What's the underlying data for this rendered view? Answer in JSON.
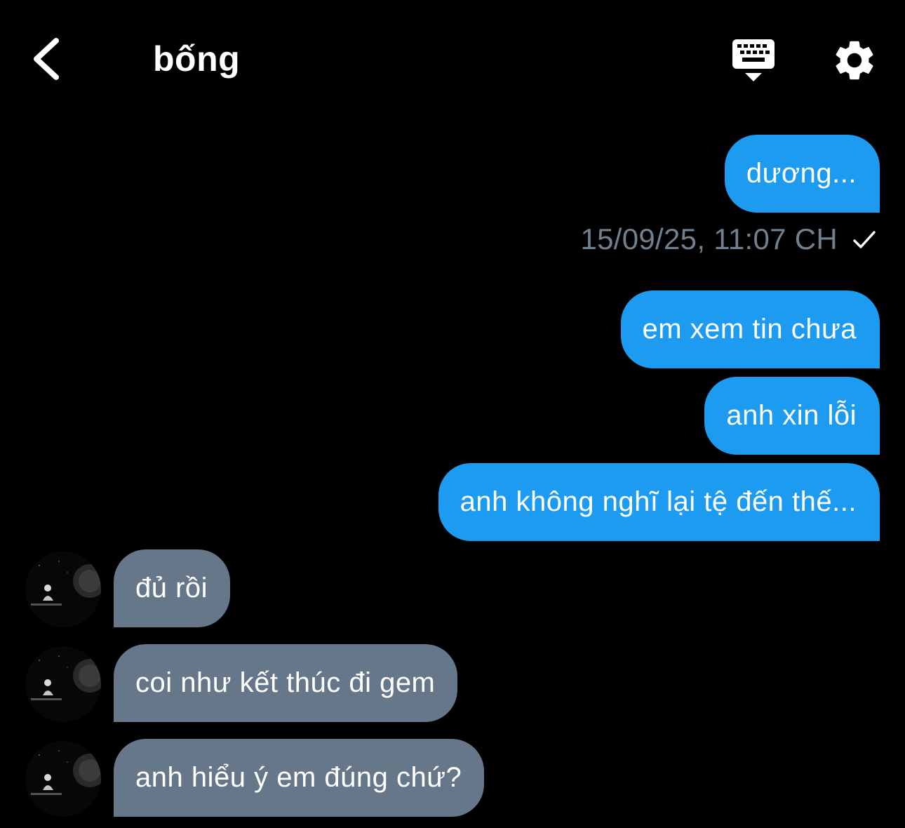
{
  "header": {
    "title": "bống",
    "back_icon": "chevron-left-icon",
    "keyboard_icon": "keyboard-dismiss-icon",
    "settings_icon": "gear-icon"
  },
  "colors": {
    "background": "#000000",
    "outgoing_bubble": "#1d9bf0",
    "incoming_bubble": "#66778a",
    "timestamp": "#71808f",
    "text": "#ffffff"
  },
  "messages": [
    {
      "direction": "outgoing",
      "text": "dương..."
    },
    {
      "direction": "outgoing",
      "text": "em xem tin chưa"
    },
    {
      "direction": "outgoing",
      "text": "anh xin lỗi"
    },
    {
      "direction": "outgoing",
      "text": "anh không nghĩ lại tệ đến thế..."
    },
    {
      "direction": "incoming",
      "text": "đủ rồi"
    },
    {
      "direction": "incoming",
      "text": "coi như kết thúc đi gem"
    },
    {
      "direction": "incoming",
      "text": "anh hiểu ý em đúng chứ?"
    }
  ],
  "status": {
    "timestamp": "15/09/25, 11:07 CH",
    "read_icon": "checkmark-icon"
  }
}
